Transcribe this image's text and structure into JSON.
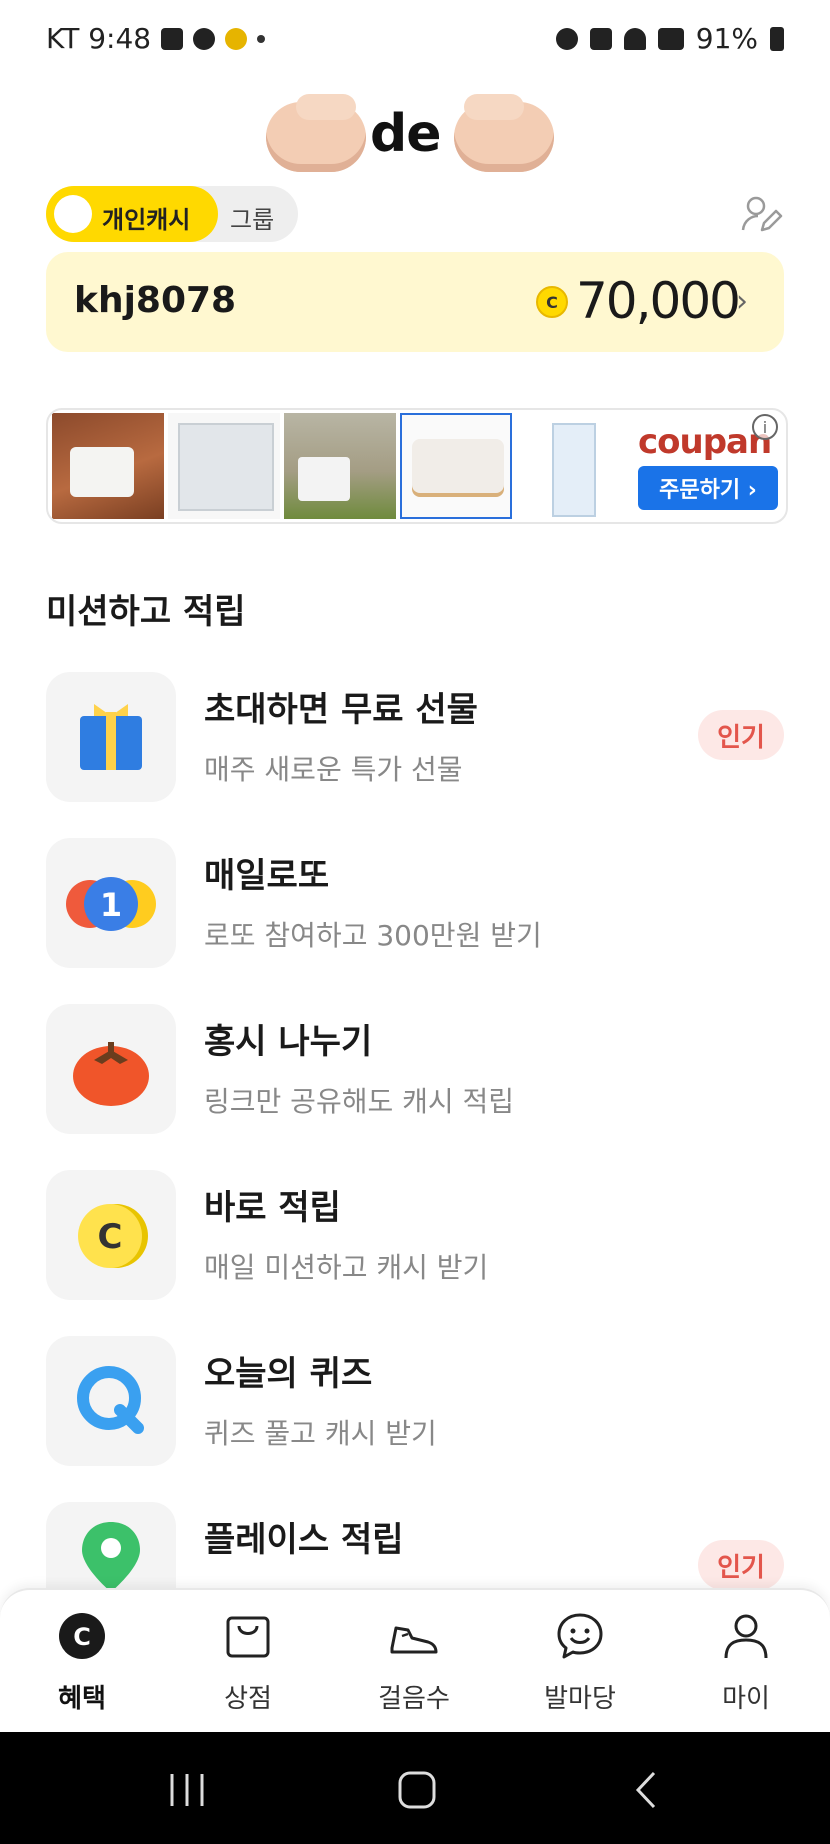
{
  "status_bar": {
    "carrier_time": "KT 9:48",
    "battery": "91%"
  },
  "logo": {
    "text": "de"
  },
  "toggle": {
    "personal_label": "개인캐시",
    "group_label": "그룹"
  },
  "balance": {
    "username": "khj8078",
    "coin_symbol": "C",
    "amount": "70,000",
    "chevron": "›"
  },
  "ad": {
    "brand": "coupan",
    "order_button": "주문하기 ›",
    "info": "i"
  },
  "section_title": "미션하고 적립",
  "missions": [
    {
      "title": "초대하면 무료 선물",
      "subtitle": "매주 새로운 특가 선물",
      "badge": "인기",
      "icon": "gift-icon"
    },
    {
      "title": "매일로또",
      "subtitle": "로또 참여하고 300만원 받기",
      "icon": "lotto-ball-icon"
    },
    {
      "title": "홍시 나누기",
      "subtitle": "링크만 공유해도 캐시 적립",
      "icon": "persimmon-icon"
    },
    {
      "title": "바로 적립",
      "subtitle": "매일 미션하고 캐시 받기",
      "icon": "coin-icon"
    },
    {
      "title": "오늘의 퀴즈",
      "subtitle": "퀴즈 풀고 캐시 받기",
      "icon": "quiz-q-icon"
    },
    {
      "title": "플레이스 적립",
      "subtitle": "",
      "badge": "인기",
      "icon": "map-pin-icon"
    }
  ],
  "bottom_nav": [
    {
      "label": "혜택",
      "icon": "cash-coin-icon",
      "active": true
    },
    {
      "label": "상점",
      "icon": "shopping-bag-icon"
    },
    {
      "label": "걸음수",
      "icon": "sneaker-icon"
    },
    {
      "label": "발마당",
      "icon": "smile-chat-icon"
    },
    {
      "label": "마이",
      "icon": "person-icon"
    }
  ],
  "colors": {
    "brand_yellow": "#ffd900",
    "card_bg": "#fff8d0",
    "badge_red": "#e3564c",
    "coupang_blue": "#1a73e8"
  }
}
